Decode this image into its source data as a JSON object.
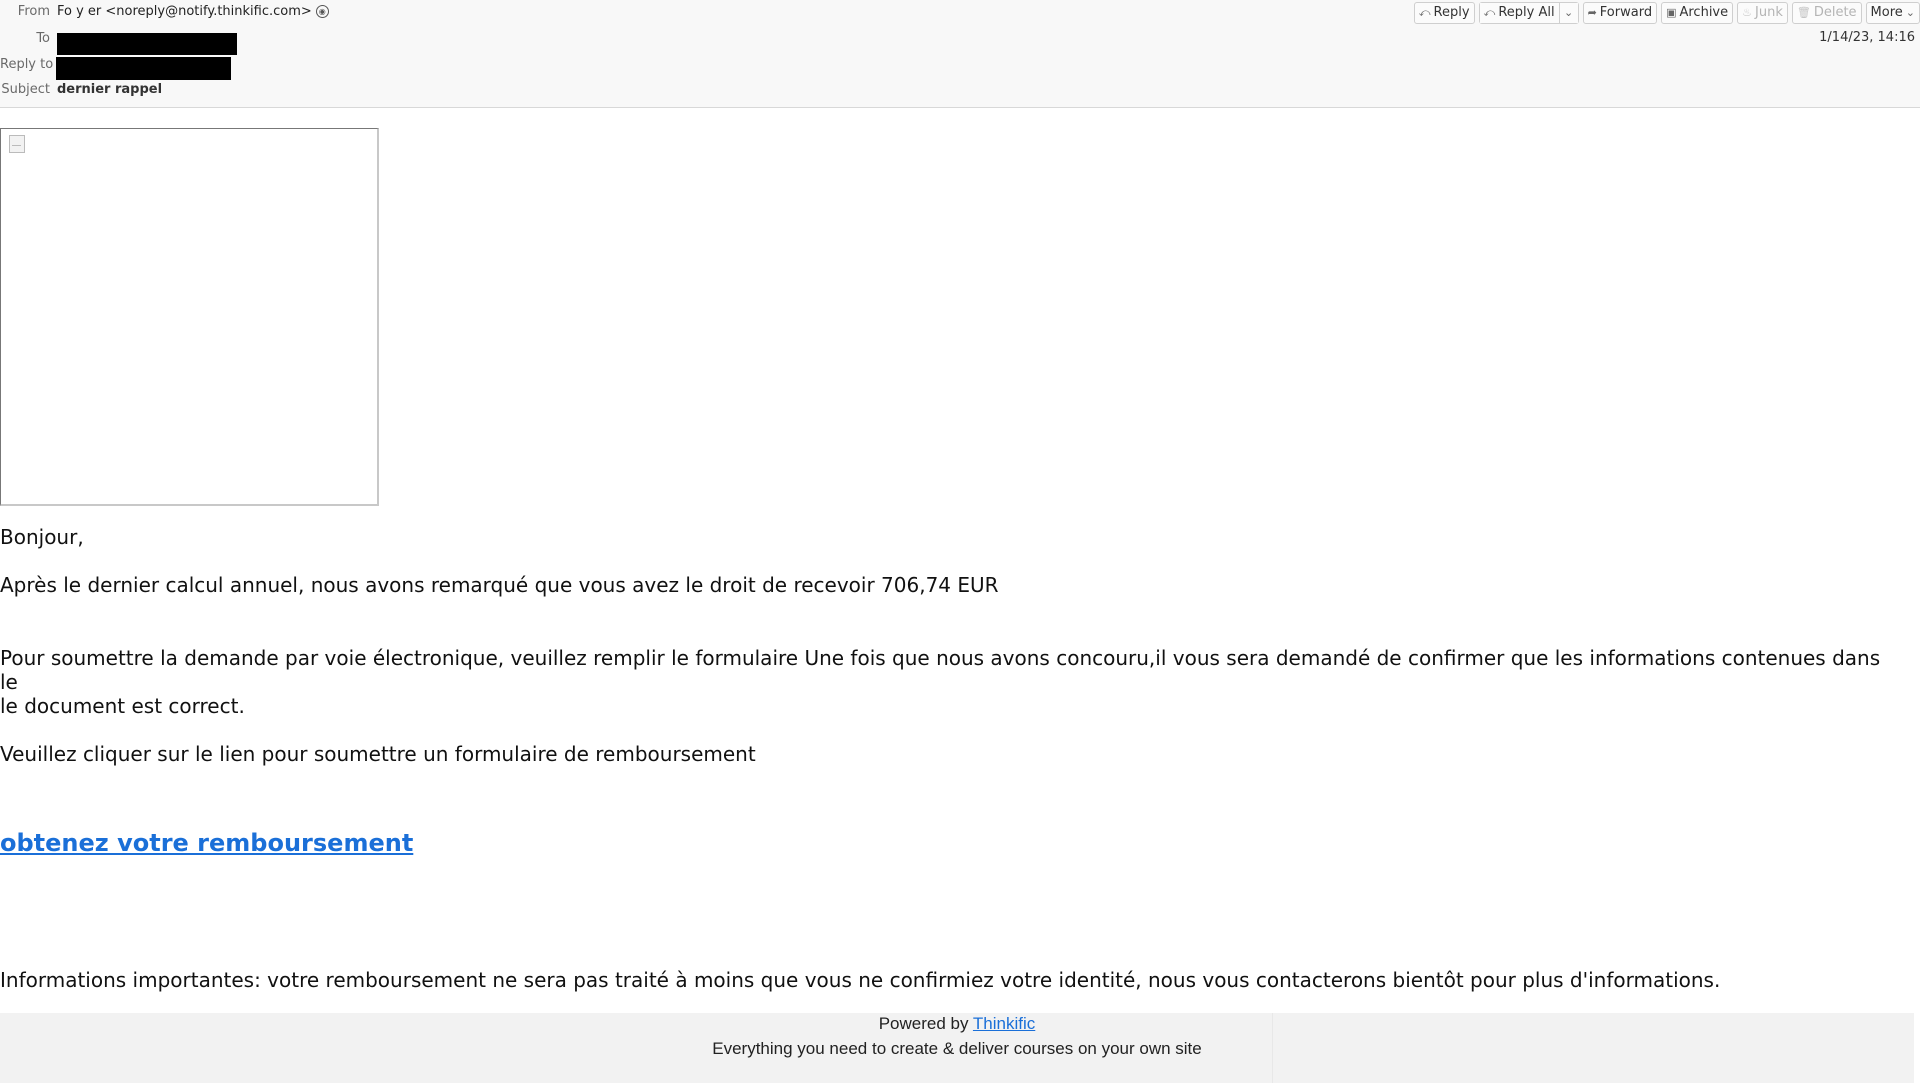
{
  "header": {
    "from_label": "From",
    "from_value": "Fo y er <noreply@notify.thinkific.com>",
    "to_label": "To",
    "reply_to_label": "Reply to",
    "subject_label": "Subject",
    "subject_value": "dernier rappel",
    "date": "1/14/23, 14:16",
    "contact_icon": "person-icon"
  },
  "toolbar": {
    "reply": "Reply",
    "reply_all": "Reply All",
    "forward": "Forward",
    "archive": "Archive",
    "junk": "Junk",
    "delete": "Delete",
    "more": "More",
    "icons": {
      "reply": "⤺",
      "reply_all": "⤺",
      "forward": "➦",
      "archive": "▣",
      "junk": "♨",
      "delete": "🗑",
      "chevron": "⌄"
    }
  },
  "body": {
    "greeting": "Bonjour,",
    "para1": "Après le dernier calcul annuel, nous avons remarqué que vous avez le droit de recevoir 706,74 EUR",
    "para2_line1": "Pour soumettre la demande par voie électronique, veuillez remplir le formulaire Une fois que nous avons concouru,il vous sera demandé de confirmer que les informations contenues dans",
    "para2_line2": "le",
    "para2_line3": "le document est correct.",
    "para3": "Veuillez cliquer sur le lien pour soumettre un formulaire de remboursement",
    "link": "obtenez votre remboursement",
    "para4": "Informations importantes: votre remboursement ne sera pas traité à moins que vous ne confirmiez votre identité, nous vous contacterons bientôt pour plus d'informations."
  },
  "footer": {
    "powered_by": "Powered by",
    "brand_link": "Thinkific",
    "tagline": "Everything you need to create & deliver courses on your own site"
  },
  "colors": {
    "link": "#1a6fd8",
    "header_bg": "#f8f8f8",
    "footer_bg": "#f2f2f2"
  }
}
